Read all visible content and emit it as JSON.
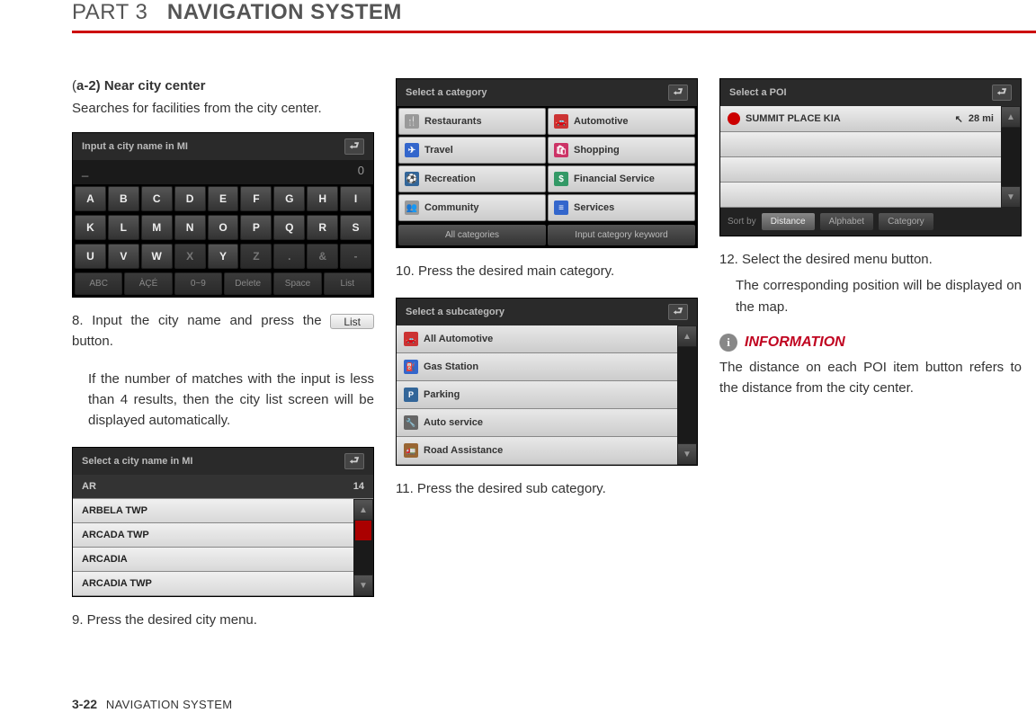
{
  "header": {
    "part": "PART 3",
    "title": "NAVIGATION SYSTEM"
  },
  "col1": {
    "subhead_paren": "(",
    "subhead_code": "a-2) Near city center",
    "lead": "Searches for facilities from the city center.",
    "screenshot_keyboard": {
      "title": "Input a city name in MI",
      "cursor": "_",
      "count": "0",
      "row1": [
        "A",
        "B",
        "C",
        "D",
        "E",
        "F",
        "G",
        "H",
        "I"
      ],
      "row2": [
        "K",
        "L",
        "M",
        "N",
        "O",
        "P",
        "Q",
        "R",
        "S"
      ],
      "row3": [
        "U",
        "V",
        "W",
        "X",
        "Y",
        "Z",
        ".",
        "&",
        "-"
      ],
      "bottom": [
        "ABC",
        "ÀÇÉ",
        "0~9",
        "Delete",
        "Space",
        "List"
      ]
    },
    "step8_a": "8. Input the city name and press the ",
    "step8_btn": "List",
    "step8_b": " button.",
    "step8_para": "If the number of matches with the input is less than 4 results, then the city list screen will be displayed automatically.",
    "screenshot_citylist": {
      "title": "Select a city name in MI",
      "input": "AR",
      "count": "14",
      "items": [
        "ARBELA TWP",
        "ARCADA TWP",
        "ARCADIA",
        "ARCADIA TWP"
      ]
    },
    "step9": "9. Press the desired city menu."
  },
  "col2": {
    "screenshot_category": {
      "title": "Select a category",
      "cells": [
        {
          "icon": "🍴",
          "label": "Restaurants"
        },
        {
          "icon": "🚗",
          "label": "Automotive"
        },
        {
          "icon": "✈",
          "label": "Travel"
        },
        {
          "icon": "🛍",
          "label": "Shopping"
        },
        {
          "icon": "⚽",
          "label": "Recreation"
        },
        {
          "icon": "$",
          "label": "Financial Service"
        },
        {
          "icon": "👥",
          "label": "Community"
        },
        {
          "icon": "≡",
          "label": "Services"
        }
      ],
      "bottom": [
        "All categories",
        "Input category keyword"
      ]
    },
    "step10": "10. Press the desired main category.",
    "screenshot_subcat": {
      "title": "Select a subcategory",
      "items": [
        {
          "icon": "🚗",
          "color": "#c33",
          "label": "All Automotive"
        },
        {
          "icon": "⛽",
          "color": "#36c",
          "label": "Gas Station"
        },
        {
          "icon": "P",
          "color": "#369",
          "label": "Parking"
        },
        {
          "icon": "🔧",
          "color": "#666",
          "label": "Auto service"
        },
        {
          "icon": "🚛",
          "color": "#963",
          "label": "Road Assistance"
        }
      ]
    },
    "step11": "11. Press the desired sub category."
  },
  "col3": {
    "screenshot_poi": {
      "title": "Select a POI",
      "item_name": "SUMMIT PLACE KIA",
      "item_dist": "28 mi",
      "sort_label": "Sort by",
      "sort_buttons": [
        "Distance",
        "Alphabet",
        "Category"
      ]
    },
    "step12": "12. Select the desired menu button.",
    "step12_para": "The corresponding position will be dis­played on the map.",
    "info_head": "INFORMATION",
    "info_text": "The distance on each POI item button refers to the distance from the city center."
  },
  "footer": {
    "page": "3-22",
    "chapter": "NAVIGATION SYSTEM"
  }
}
